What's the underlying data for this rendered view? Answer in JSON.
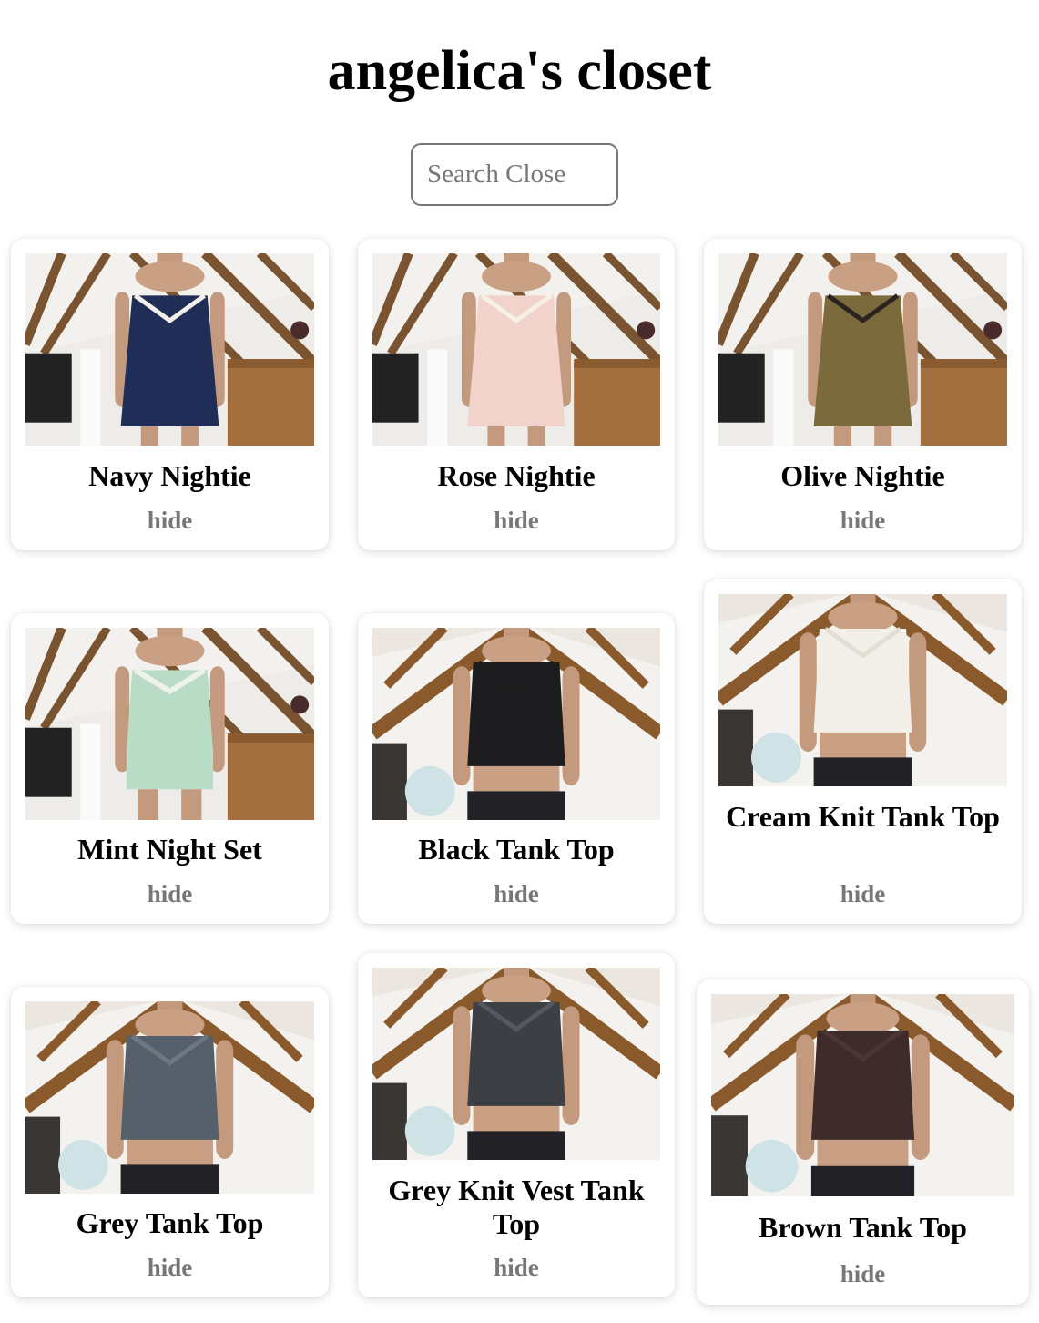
{
  "page": {
    "title": "angelica's closet"
  },
  "search": {
    "placeholder": "Search Close"
  },
  "items": [
    {
      "name": "Navy Nightie",
      "action": "hide",
      "garment": "dress",
      "color": "#1f2d57",
      "trim": "#f3f0ea",
      "scene": "loft"
    },
    {
      "name": "Rose Nightie",
      "action": "hide",
      "garment": "dress",
      "color": "#f1d3cb",
      "trim": "#f7f1e4",
      "scene": "loft"
    },
    {
      "name": "Olive Nightie",
      "action": "hide",
      "garment": "dress",
      "color": "#7a6a3c",
      "trim": "#2a241f",
      "scene": "loft"
    },
    {
      "name": "Mint Night Set",
      "action": "hide",
      "garment": "set",
      "color": "#b9dcc6",
      "trim": "#eef2ea",
      "scene": "loft"
    },
    {
      "name": "Black Tank Top",
      "action": "hide",
      "garment": "top",
      "color": "#1d1d1f",
      "trim": "#1d1d1f",
      "scene": "attic"
    },
    {
      "name": "Cream Knit Tank Top",
      "action": "hide",
      "garment": "top",
      "color": "#f1efe8",
      "trim": "#e2ded4",
      "scene": "attic"
    },
    {
      "name": "Grey Tank Top",
      "action": "hide",
      "garment": "top",
      "color": "#56606a",
      "trim": "#6d7781",
      "scene": "attic"
    },
    {
      "name": "Grey Knit Vest Tank Top",
      "action": "hide",
      "garment": "top",
      "color": "#3c3f44",
      "trim": "#55585d",
      "scene": "attic"
    },
    {
      "name": "Brown Tank Top",
      "action": "hide",
      "garment": "top",
      "color": "#3f2b2a",
      "trim": "#4c3634",
      "scene": "attic"
    }
  ]
}
